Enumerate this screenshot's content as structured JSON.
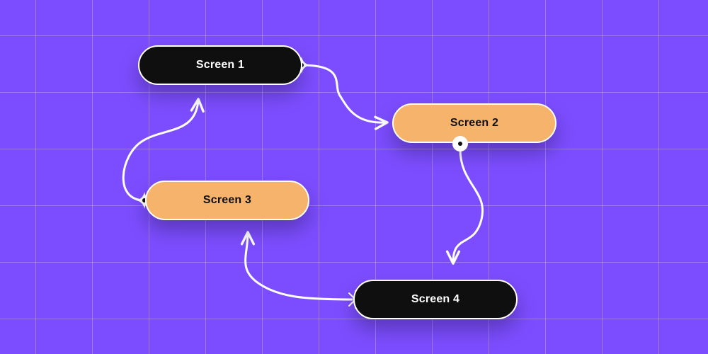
{
  "nodes": {
    "screen1": {
      "label": "Screen 1"
    },
    "screen2": {
      "label": "Screen 2"
    },
    "screen3": {
      "label": "Screen 3"
    },
    "screen4": {
      "label": "Screen 4"
    }
  }
}
